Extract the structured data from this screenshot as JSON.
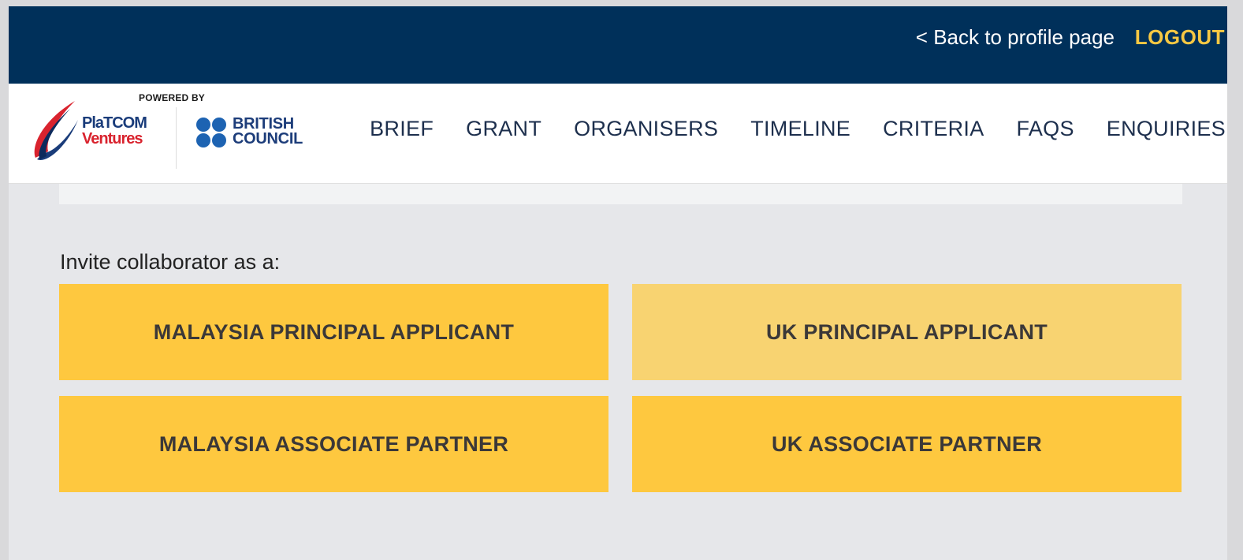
{
  "topbar": {
    "back_link": "< Back to profile page",
    "logout": "LOGOUT"
  },
  "header": {
    "powered_by": "POWERED BY",
    "platcom_line1": "PlaTCOM",
    "platcom_line2": "Ventures",
    "british_council_line1": "BRITISH",
    "british_council_line2": "COUNCIL",
    "nav": [
      "BRIEF",
      "GRANT",
      "ORGANISERS",
      "TIMELINE",
      "CRITERIA",
      "FAQS",
      "ENQUIRIES"
    ]
  },
  "main": {
    "invite_label": "Invite collaborator as a:",
    "options": [
      "MALAYSIA PRINCIPAL APPLICANT",
      "UK PRINCIPAL APPLICANT",
      "MALAYSIA ASSOCIATE PARTNER",
      "UK ASSOCIATE PARTNER"
    ]
  },
  "colors": {
    "topbar": "#00305a",
    "logout": "#f7c843",
    "button": "#fec83f",
    "button_hover": "#f8d371"
  }
}
